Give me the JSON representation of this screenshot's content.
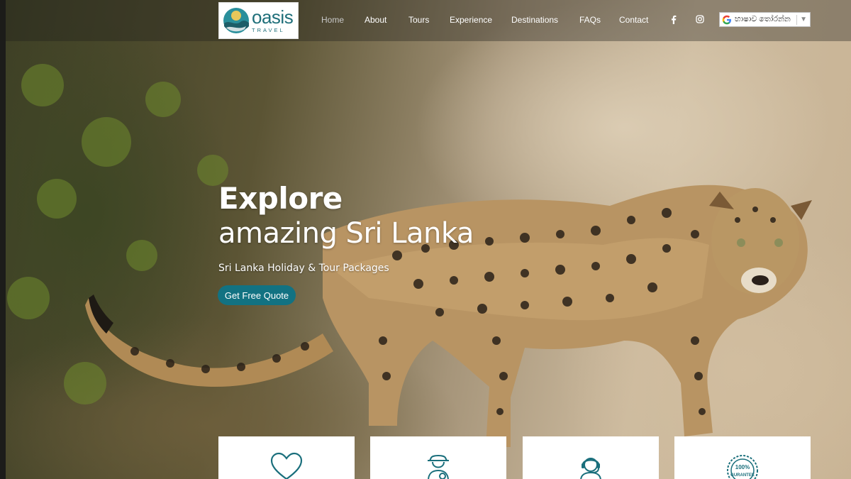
{
  "logo": {
    "word": "oasis",
    "sub": "TRAVEL"
  },
  "nav": [
    {
      "label": "Home",
      "active": true
    },
    {
      "label": "About"
    },
    {
      "label": "Tours"
    },
    {
      "label": "Experience"
    },
    {
      "label": "Destinations"
    },
    {
      "label": "FAQs"
    },
    {
      "label": "Contact"
    }
  ],
  "social": {
    "facebook_icon": "facebook-icon",
    "instagram_icon": "instagram-icon"
  },
  "translate": {
    "label": "භාෂාව තෝරන්න",
    "arrow": "▼"
  },
  "hero": {
    "title": "Explore",
    "subtitle": "amazing Sri Lanka",
    "tagline": "Sri Lanka Holiday & Tour Packages",
    "cta": "Get Free Quote"
  },
  "cards": [
    {
      "icon": "heart-icon"
    },
    {
      "icon": "explorer-icon"
    },
    {
      "icon": "support-agent-icon"
    },
    {
      "icon": "guarantee-badge-icon",
      "badge_text": "100%",
      "badge_sub": "GURANTEE"
    }
  ],
  "colors": {
    "accent": "#127282",
    "logo_teal": "#1f6f7a"
  }
}
